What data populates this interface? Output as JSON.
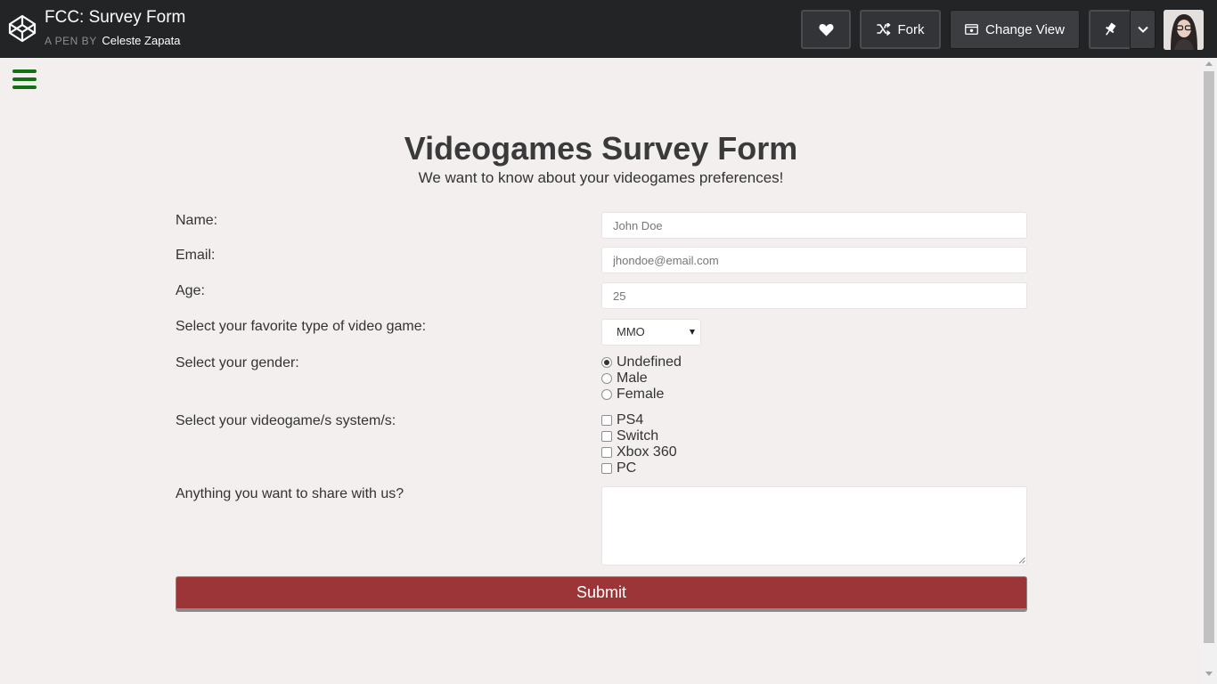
{
  "header": {
    "pen_title": "FCC: Survey Form",
    "pen_by_label": "A PEN BY",
    "author": "Celeste Zapata",
    "fork_label": "Fork",
    "change_view_label": "Change View"
  },
  "form": {
    "title": "Videogames Survey Form",
    "description": "We want to know about your videogames preferences!",
    "name_label": "Name:",
    "name_placeholder": "John Doe",
    "email_label": "Email:",
    "email_placeholder": "jhondoe@email.com",
    "age_label": "Age:",
    "age_placeholder": "25",
    "game_type_label": "Select your favorite type of video game:",
    "game_type_selected": "MMO",
    "gender_label": "Select your gender:",
    "gender_options": [
      {
        "label": "Undefined",
        "checked": true
      },
      {
        "label": "Male",
        "checked": false
      },
      {
        "label": "Female",
        "checked": false
      }
    ],
    "systems_label": "Select your videogame/s system/s:",
    "systems_options": [
      {
        "label": "PS4",
        "checked": false
      },
      {
        "label": "Switch",
        "checked": false
      },
      {
        "label": "Xbox 360",
        "checked": false
      },
      {
        "label": "PC",
        "checked": false
      }
    ],
    "comments_label": "Anything you want to share with us?",
    "submit_label": "Submit"
  },
  "colors": {
    "topbar": "#232426",
    "page_bg": "#f3efee",
    "hamburger": "#137013",
    "submit_bg": "#9b3538"
  }
}
